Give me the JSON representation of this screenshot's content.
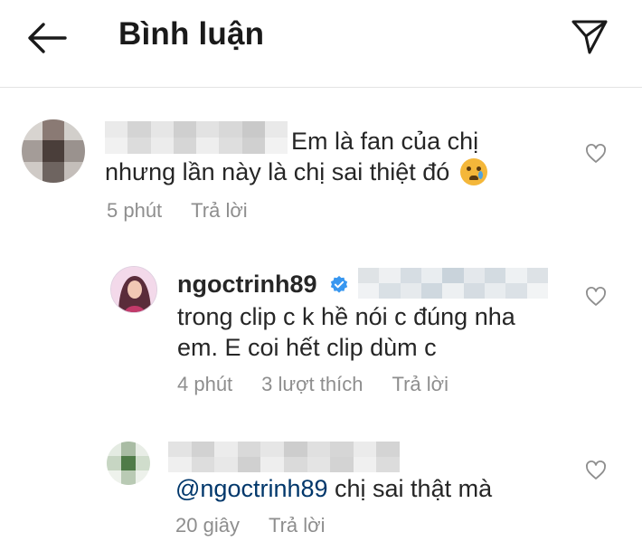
{
  "header": {
    "title": "Bình luận"
  },
  "comments": [
    {
      "line1": "Em là fan của chị",
      "line2": "nhưng lần này là chị sai thiệt đó",
      "emoji": "crying-face",
      "time": "5 phút",
      "reply_label": "Trả lời"
    },
    {
      "username": "ngoctrinh89",
      "verified": true,
      "line1": "trong clip c k hề nói c đúng nha",
      "line2": "em. E coi hết clip dùm c",
      "time": "4 phút",
      "likes": "3 lượt thích",
      "reply_label": "Trả lời"
    },
    {
      "mention": "@ngoctrinh89",
      "text": " chị sai thật mà",
      "time": "20 giây",
      "reply_label": "Trả lời"
    }
  ],
  "colors": {
    "text": "#262626",
    "muted": "#8e8e8e",
    "mention": "#00376b",
    "verified": "#3897f0"
  },
  "icons": {
    "back": "arrow-left-icon",
    "send": "paper-plane-icon",
    "like": "heart-outline-icon",
    "verified": "verified-badge-icon"
  }
}
